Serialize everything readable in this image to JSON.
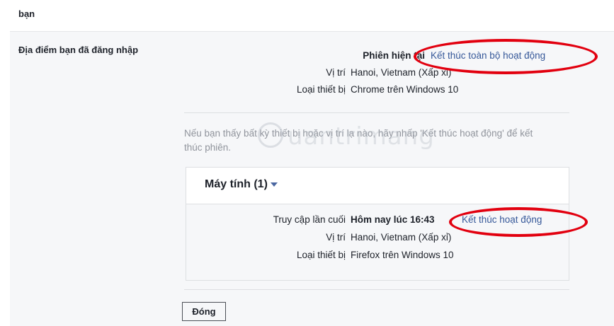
{
  "top": {
    "label": "bạn"
  },
  "section": {
    "title": "Địa điểm bạn đã đăng nhập"
  },
  "current_session": {
    "label": "Phiên hiện tại",
    "end_all_link": "Kết thúc toàn bộ hoạt động",
    "location_key": "Vị trí",
    "location_value": "Hanoi, Vietnam (Xấp xỉ)",
    "device_key": "Loại thiết bị",
    "device_value": "Chrome trên Windows 10"
  },
  "notice": "Nếu bạn thấy bất kỳ thiết bị hoặc vị trí lạ nào, hãy nhấp 'Kết thúc hoạt động' để kết thúc phiên.",
  "device_group": {
    "title": "Máy tính (1)",
    "last_access_key": "Truy cập lần cuối",
    "last_access_value": "Hôm nay lúc 16:43",
    "end_link": "Kết thúc hoạt động",
    "location_key": "Vị trí",
    "location_value": "Hanoi, Vietnam (Xấp xỉ)",
    "device_key": "Loại thiết bị",
    "device_value": "Firefox trên Windows 10"
  },
  "close_button": "Đóng",
  "watermark": "uantrimang",
  "colors": {
    "link": "#365899",
    "annotation": "#e2000f",
    "panel_bg": "#f6f7f9"
  }
}
